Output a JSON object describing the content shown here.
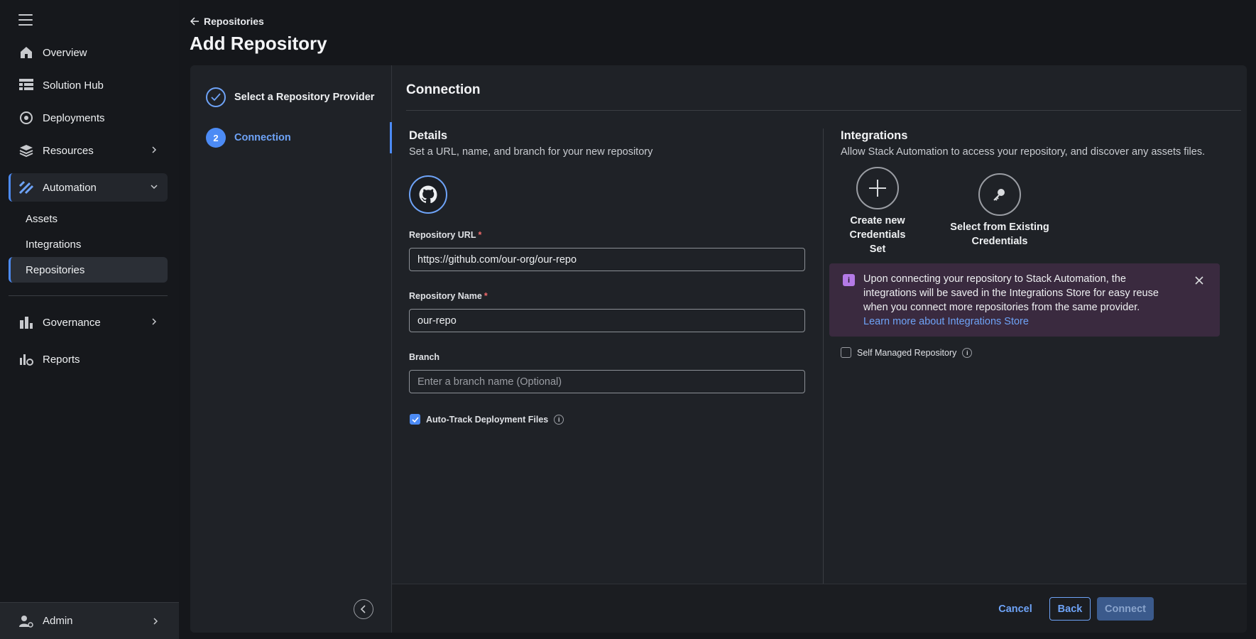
{
  "sidebar": {
    "items": [
      {
        "label": "Overview",
        "icon": "home-icon"
      },
      {
        "label": "Solution Hub",
        "icon": "grid-icon"
      },
      {
        "label": "Deployments",
        "icon": "deployments-icon"
      },
      {
        "label": "Resources",
        "icon": "layers-icon"
      },
      {
        "label": "Automation",
        "icon": "automation-icon"
      },
      {
        "label": "Governance",
        "icon": "governance-icon"
      },
      {
        "label": "Reports",
        "icon": "reports-icon"
      }
    ],
    "sub_items": [
      "Assets",
      "Integrations",
      "Repositories"
    ],
    "admin_label": "Admin"
  },
  "header": {
    "breadcrumb": "Repositories",
    "title": "Add Repository"
  },
  "steps": [
    {
      "label": "Select a Repository Provider",
      "state": "done"
    },
    {
      "number": "2",
      "label": "Connection",
      "state": "current"
    }
  ],
  "content": {
    "title": "Connection",
    "details": {
      "heading": "Details",
      "subtitle": "Set a URL, name, and branch for your new repository",
      "provider_icon": "github-icon",
      "url_label": "Repository URL",
      "url_value": "https://github.com/our-org/our-repo",
      "name_label": "Repository Name",
      "name_value": "our-repo",
      "branch_label": "Branch",
      "branch_placeholder": "Enter a branch name (Optional)",
      "required_mark": "*",
      "auto_track_label": "Auto-Track Deployment Files",
      "info_glyph": "i"
    },
    "integrations": {
      "heading": "Integrations",
      "subtitle": "Allow Stack Automation to access your repository, and discover any assets files.",
      "create_label_1": "Create new",
      "create_label_2": "Credentials",
      "create_label_3": "Set",
      "select_label_1": "Select from Existing",
      "select_label_2": "Credentials",
      "banner_icon": "i",
      "banner_line1": "Upon connecting your repository to Stack Automation, the",
      "banner_line2": "integrations will be saved in the Integrations Store for easy reuse",
      "banner_line3": "when you connect more repositories from the same provider.",
      "banner_link": "Learn more about Integrations Store",
      "self_managed_label": "Self Managed Repository"
    }
  },
  "footer": {
    "cancel": "Cancel",
    "back": "Back",
    "connect": "Connect"
  },
  "colors": {
    "accent": "#4c8bf5",
    "link": "#6ea3f7",
    "banner_bg": "#3a2a3f",
    "banner_icon": "#b47ae6",
    "required": "#f06a6a"
  }
}
